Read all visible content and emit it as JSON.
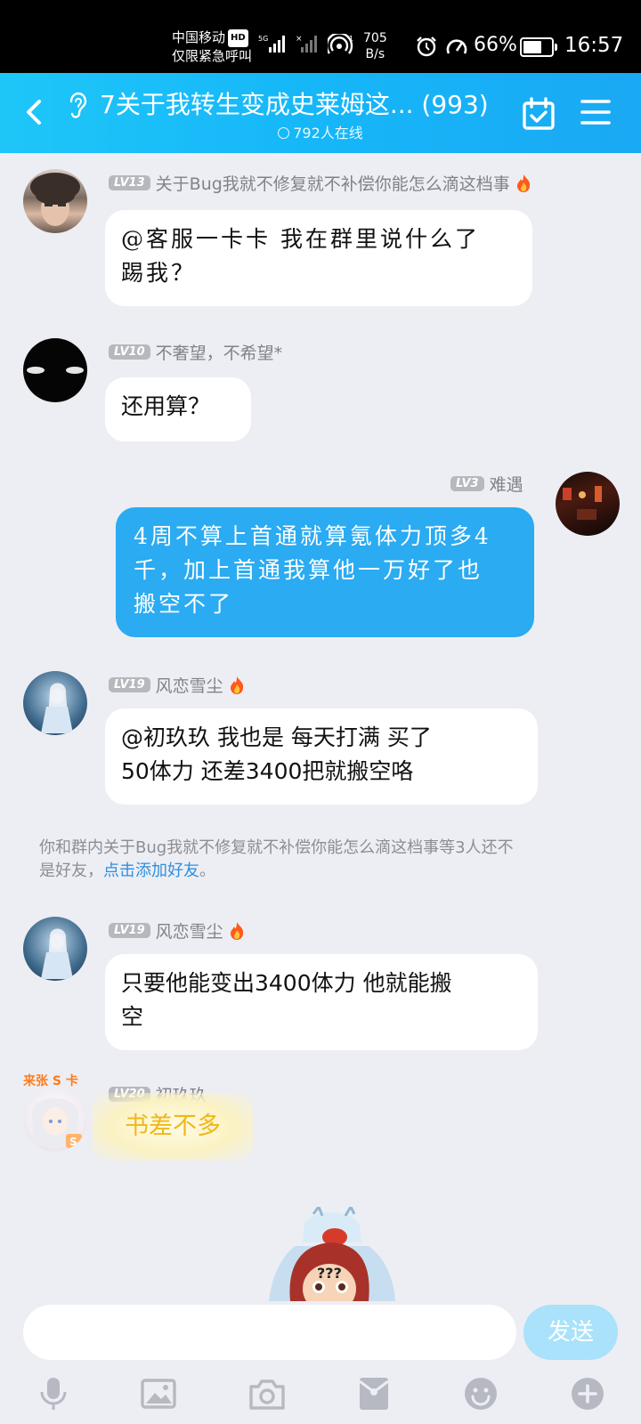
{
  "status_bar": {
    "carrier": "中国移动",
    "hd": "HD",
    "emergency": "仅限紧急呼叫",
    "net_speed_value": "705",
    "net_speed_unit": "B/s",
    "battery": "66%",
    "battery_level": 0.66,
    "time": "16:57"
  },
  "header": {
    "title": "7关于我转生变成史莱姆这... (993)",
    "online": "792人在线"
  },
  "messages": [
    {
      "level": "LV13",
      "name": "关于Bug我就不修复就不补偿你能怎么滴这档事",
      "text_line1": "@客服一卡卡 我在群里说什么了",
      "text_line2": "踢我？"
    },
    {
      "level": "LV10",
      "name": "不奢望，不希望*",
      "text": "还用算？"
    },
    {
      "level": "LV3",
      "name": "难遇",
      "text_line1": "4周不算上首通就算氪体力顶多4",
      "text_line2": "千，加上首通我算他一万好了也",
      "text_line3": "搬空不了"
    },
    {
      "level": "LV19",
      "name": "风恋雪尘",
      "text_line1": "@初玖玖 我也是 每天打满 买了",
      "text_line2": "50体力 还差3400把就搬空咯"
    },
    {
      "level": "LV19",
      "name": "风恋雪尘",
      "text_line1": "只要他能变出3400体力 他就能搬",
      "text_line2": "空"
    },
    {
      "level": "LV20",
      "name": "初玖玖",
      "badge": "来张 S 卡",
      "text": "书差不多"
    }
  ],
  "system_note": {
    "text_line1": "你和群内关于Bug我就不修复就不补偿你能怎么滴这档事等3人还不",
    "text_line2_prefix": "是好友，",
    "link": "点击添加好友",
    "suffix": "。"
  },
  "sticker": {
    "marks": "???"
  },
  "input": {
    "placeholder": "",
    "send_label": "发送"
  },
  "colors": {
    "header": "#1ab8f7",
    "mine_bubble": "#2aabf2",
    "send_btn": "#a9e2fa",
    "link": "#2d8fe0"
  }
}
